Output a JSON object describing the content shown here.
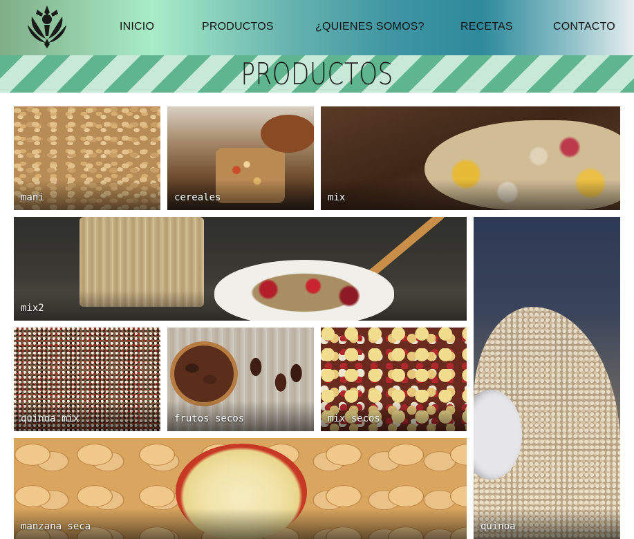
{
  "header": {
    "logo_icon": "lotus-leaf-logo-icon",
    "nav": [
      {
        "label": "INICIO"
      },
      {
        "label": "PRODUCTOS"
      },
      {
        "label": "¿QUIENES SOMOS?"
      },
      {
        "label": "RECETAS"
      },
      {
        "label": "CONTACTO"
      }
    ]
  },
  "page_title": "PRODUCTOS",
  "products": [
    {
      "label": "mani"
    },
    {
      "label": "cereales"
    },
    {
      "label": "mix"
    },
    {
      "label": "mix2"
    },
    {
      "label": "quinoa mix"
    },
    {
      "label": "frutos secos"
    },
    {
      "label": "mix secos"
    },
    {
      "label": "manzana seca"
    },
    {
      "label": "quinoa"
    }
  ],
  "colors": {
    "band_dark": "#5fb58e",
    "band_light": "#c8e9d8",
    "logo": "#1a1a1a"
  }
}
